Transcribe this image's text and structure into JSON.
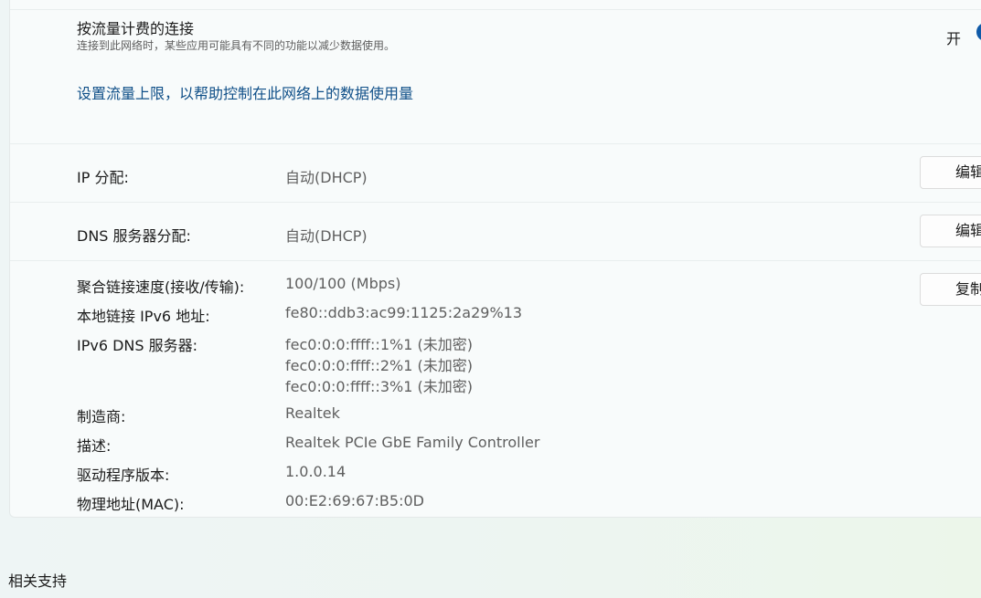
{
  "metered": {
    "title": "按流量计费的连接",
    "description": "连接到此网络时，某些应用可能具有不同的功能以减少数据使用。",
    "toggle_label": "开",
    "toggle_on": true,
    "data_limit_link": "设置流量上限，以帮助控制在此网络上的数据使用量"
  },
  "ip_assignment": {
    "label": "IP 分配:",
    "value": "自动(DHCP)",
    "edit_label": "编辑"
  },
  "dns_assignment": {
    "label": "DNS 服务器分配:",
    "value": "自动(DHCP)",
    "edit_label": "编辑"
  },
  "details": {
    "copy_label": "复制",
    "link_speed": {
      "label": "聚合链接速度(接收/传输):",
      "value": "100/100 (Mbps)"
    },
    "ipv6_link_local": {
      "label": "本地链接 IPv6 地址:",
      "value": "fe80::ddb3:ac99:1125:2a29%13"
    },
    "ipv6_dns": {
      "label": "IPv6 DNS 服务器:",
      "values": [
        "fec0:0:0:ffff::1%1 (未加密)",
        "fec0:0:0:ffff::2%1 (未加密)",
        "fec0:0:0:ffff::3%1 (未加密)"
      ]
    },
    "manufacturer": {
      "label": "制造商:",
      "value": "Realtek"
    },
    "description": {
      "label": "描述:",
      "value": "Realtek PCIe GbE Family Controller"
    },
    "driver_version": {
      "label": "驱动程序版本:",
      "value": "1.0.0.14"
    },
    "mac": {
      "label": "物理地址(MAC):",
      "value": "00:E2:69:67:B5:0D"
    }
  },
  "related": {
    "title": "相关支持"
  },
  "colors": {
    "accent": "#0f5aa8",
    "link": "#0f4f88"
  }
}
